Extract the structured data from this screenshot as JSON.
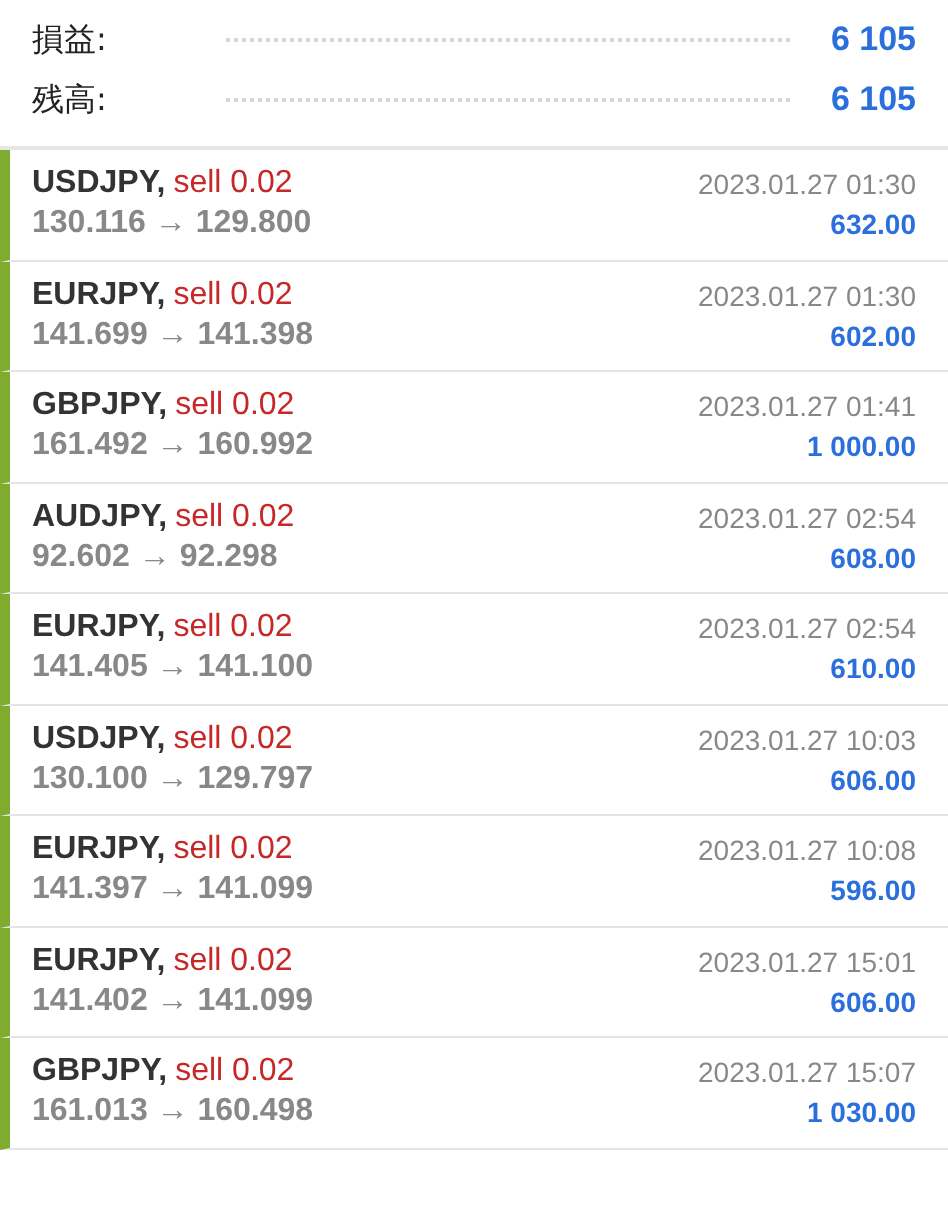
{
  "summary": [
    {
      "label": "損益:",
      "value": "6 105"
    },
    {
      "label": "残高:",
      "value": "6 105"
    }
  ],
  "deals": [
    {
      "symbol": "USDJPY,",
      "order": "sell 0.02",
      "kind": "sell",
      "prices": "130.116 → 129.800",
      "time": "2023.01.27 01:30",
      "profit": "632.00"
    },
    {
      "symbol": "EURJPY,",
      "order": "sell 0.02",
      "kind": "sell",
      "prices": "141.699 → 141.398",
      "time": "2023.01.27 01:30",
      "profit": "602.00"
    },
    {
      "symbol": "GBPJPY,",
      "order": "sell 0.02",
      "kind": "sell",
      "prices": "161.492 → 160.992",
      "time": "2023.01.27 01:41",
      "profit": "1 000.00"
    },
    {
      "symbol": "AUDJPY,",
      "order": "sell 0.02",
      "kind": "sell",
      "prices": "92.602 → 92.298",
      "time": "2023.01.27 02:54",
      "profit": "608.00"
    },
    {
      "symbol": "EURJPY,",
      "order": "sell 0.02",
      "kind": "sell",
      "prices": "141.405 → 141.100",
      "time": "2023.01.27 02:54",
      "profit": "610.00"
    },
    {
      "symbol": "USDJPY,",
      "order": "sell 0.02",
      "kind": "sell",
      "prices": "130.100 → 129.797",
      "time": "2023.01.27 10:03",
      "profit": "606.00"
    },
    {
      "symbol": "EURJPY,",
      "order": "sell 0.02",
      "kind": "sell",
      "prices": "141.397 → 141.099",
      "time": "2023.01.27 10:08",
      "profit": "596.00"
    },
    {
      "symbol": "EURJPY,",
      "order": "sell 0.02",
      "kind": "sell",
      "prices": "141.402 → 141.099",
      "time": "2023.01.27 15:01",
      "profit": "606.00"
    },
    {
      "symbol": "GBPJPY,",
      "order": "sell 0.02",
      "kind": "sell",
      "prices": "161.013 → 160.498",
      "time": "2023.01.27 15:07",
      "profit": "1 030.00"
    }
  ]
}
